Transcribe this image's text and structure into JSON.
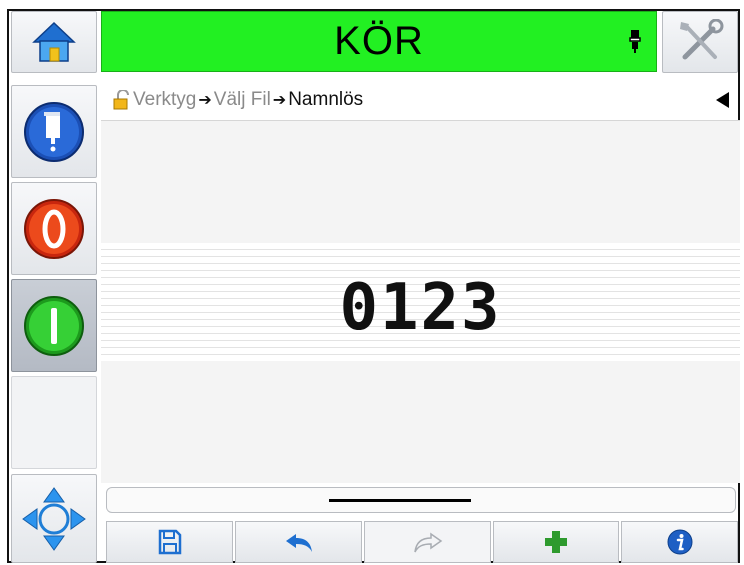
{
  "header": {
    "status_text": "KÖR",
    "status_color": "#22f022",
    "home_icon": "home-icon",
    "tools_icon": "tools-icon",
    "ink_icon": "ink-bottle-icon"
  },
  "breadcrumb": {
    "lock_icon": "lock-icon",
    "items": [
      "Verktyg",
      "Välj Fil",
      "Namnlös"
    ],
    "separator": "➔",
    "back_icon": "back-arrow-icon"
  },
  "sidebar": {
    "buttons": [
      {
        "name": "ink-system-button",
        "icon": "ink-drop-icon"
      },
      {
        "name": "stop-button",
        "icon": "stop-circle-icon"
      },
      {
        "name": "start-button",
        "icon": "start-circle-icon",
        "pressed": true
      },
      {
        "name": "blank-button"
      },
      {
        "name": "navigate-button",
        "icon": "four-arrows-icon"
      }
    ]
  },
  "editor": {
    "message_text": "0123"
  },
  "toolbar": {
    "buttons": [
      {
        "name": "save-button",
        "icon": "floppy-disk-icon"
      },
      {
        "name": "undo-button",
        "icon": "undo-arrow-icon"
      },
      {
        "name": "redo-button",
        "icon": "redo-arrow-icon",
        "disabled": true
      },
      {
        "name": "add-button",
        "icon": "plus-icon"
      },
      {
        "name": "info-button",
        "icon": "info-icon"
      }
    ]
  }
}
